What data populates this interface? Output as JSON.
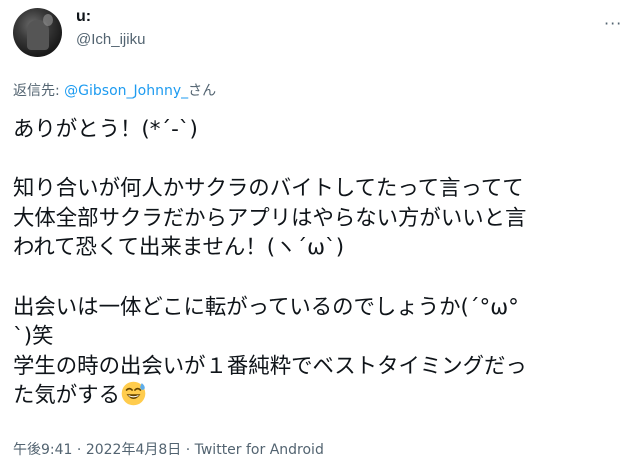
{
  "user": {
    "display_name": "u:",
    "handle": "@Ich_ijiku"
  },
  "reply": {
    "prefix": "返信先: ",
    "mention": "@Gibson_Johnny_",
    "suffix": "さん"
  },
  "body": {
    "lines": [
      "ありがとう！(*´-`)",
      "知り合いが何人かサクラのバイトしてたって言ってて",
      "大体全部サクラだからアプリはやらない方がいいと言",
      "われて恐くて出来ません！(ヽ´ω`)",
      "出会いは一体どこに転がっているのでしょうか(´°ω°",
      "`)笑",
      "学生の時の出会いが１番純粋でベストタイミングだっ",
      "た気がする"
    ],
    "emoji": "grinning-face-with-sweat-icon"
  },
  "meta": {
    "time": "午後9:41",
    "sep1": " · ",
    "date": "2022年4月8日",
    "sep2": " · ",
    "source": "Twitter for Android"
  },
  "colors": {
    "text": "#0f1419",
    "secondary": "#536471",
    "link": "#1d9bf0"
  }
}
